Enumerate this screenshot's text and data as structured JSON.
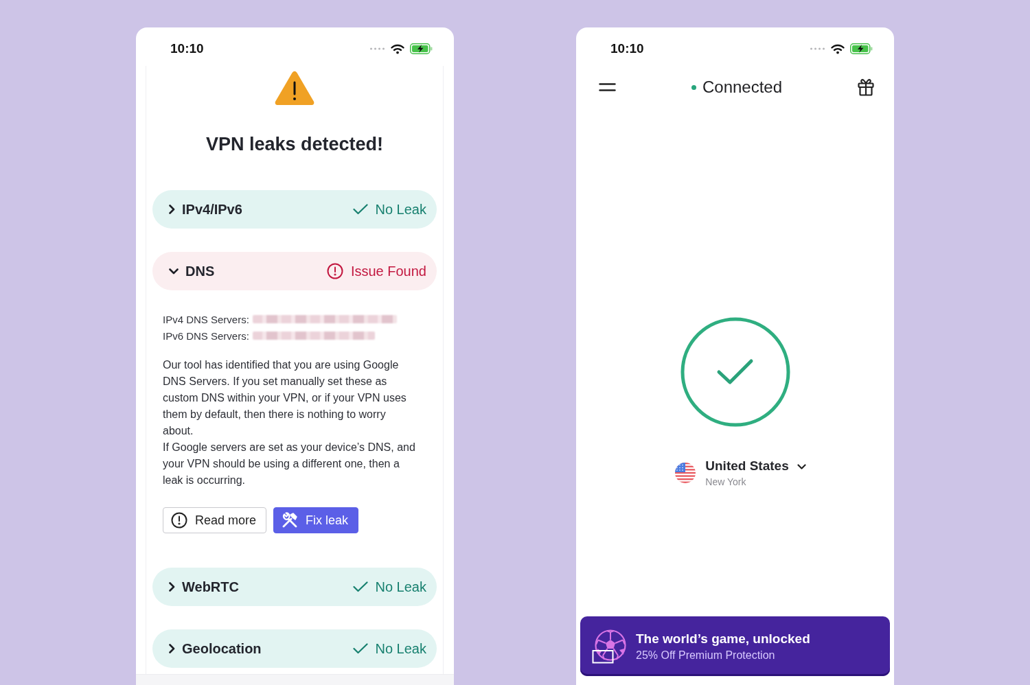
{
  "leak_test_screen": {
    "status_bar": {
      "time": "10:10"
    },
    "title": "VPN leaks detected!",
    "checks": [
      {
        "name": "IPv4/IPv6",
        "result": "No Leak",
        "kind": "pass",
        "expanded": false
      },
      {
        "name": "DNS",
        "result": "Issue Found",
        "kind": "issue",
        "expanded": true,
        "details": {
          "servers": [
            "IPv4 DNS Servers:",
            "IPv6 DNS Servers:"
          ],
          "paragraphs": [
            "Our tool has identified that you are using Google DNS Servers. If you set manually set these as custom DNS within your VPN, or if your VPN uses them by default, then there is nothing to worry about.",
            "If Google servers are set as your device’s DNS, and your VPN should be using a different one, then a leak is occurring."
          ],
          "buttons": [
            {
              "label": "Read more",
              "kind": "secondary"
            },
            {
              "label": "Fix leak",
              "kind": "primary"
            }
          ]
        }
      },
      {
        "name": "WebRTC",
        "result": "No Leak",
        "kind": "pass",
        "expanded": false
      },
      {
        "name": "Geolocation",
        "result": "No Leak",
        "kind": "pass",
        "expanded": false
      }
    ]
  },
  "vpn_screen": {
    "status_bar": {
      "time": "10:10"
    },
    "status": {
      "label": "Connected",
      "connected": true
    },
    "location": {
      "country": "United States",
      "city": "New York"
    },
    "promo": {
      "title": "The world’s game, unlocked",
      "subtitle": "25% Off Premium Protection"
    }
  }
}
